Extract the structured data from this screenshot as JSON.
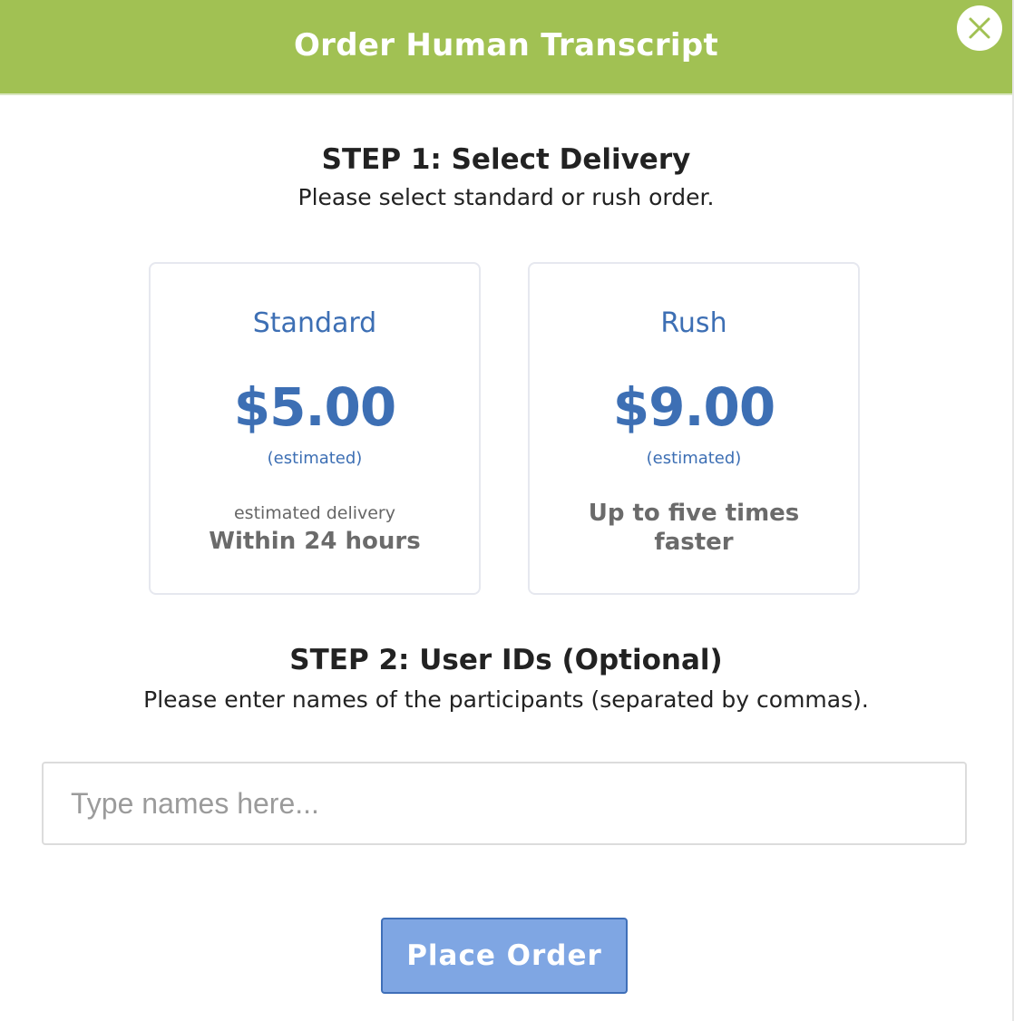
{
  "modal": {
    "title": "Order Human Transcript",
    "close_icon": "close-icon",
    "header_color": "#a1c153"
  },
  "step1": {
    "title": "STEP 1: Select Delivery",
    "subtitle": "Please select standard or rush order."
  },
  "options": [
    {
      "name": "Standard",
      "price": "$5.00",
      "estimated_label": "(estimated)",
      "detail_small": "estimated delivery",
      "detail_strong": "Within 24 hours"
    },
    {
      "name": "Rush",
      "price": "$9.00",
      "estimated_label": "(estimated)",
      "detail_strong_line1": "Up to five times",
      "detail_strong_line2": "faster"
    }
  ],
  "step2": {
    "title": "STEP 2: User IDs (Optional)",
    "subtitle": "Please enter names of the participants (separated by commas).",
    "input_value": "",
    "input_placeholder": "Type names here..."
  },
  "actions": {
    "place_order_label": "Place Order"
  },
  "colors": {
    "accent_blue": "#3d6fb4",
    "button_blue": "#7fa6e3",
    "header_green": "#a1c153"
  }
}
